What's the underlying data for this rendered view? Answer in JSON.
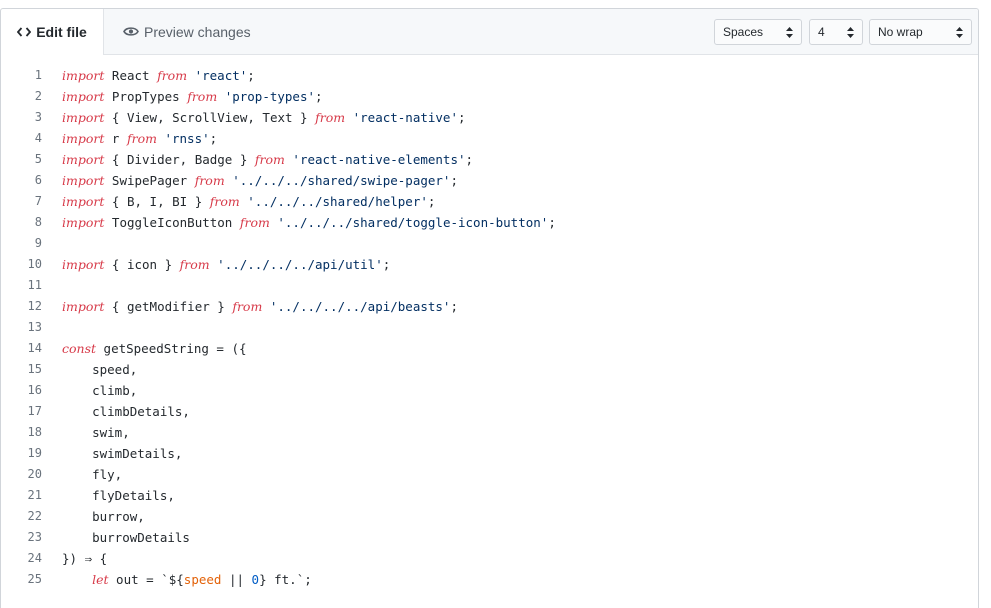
{
  "tabs": {
    "edit": {
      "label": "Edit file",
      "icon": "code-icon"
    },
    "preview": {
      "label": "Preview changes",
      "icon": "eye-icon"
    }
  },
  "options": {
    "indent_mode": "Spaces",
    "indent_size": "4",
    "wrap_mode": "No wrap"
  },
  "colors": {
    "keyword": "#d73a49",
    "string": "#032f62",
    "variable": "#e36209",
    "number": "#005cc5"
  },
  "code_lines": [
    {
      "n": "1",
      "tokens": [
        [
          "kw",
          "import"
        ],
        [
          "p",
          " React "
        ],
        [
          "kw",
          "from"
        ],
        [
          "p",
          " "
        ],
        [
          "str",
          "'react'"
        ],
        [
          "p",
          ";"
        ]
      ]
    },
    {
      "n": "2",
      "tokens": [
        [
          "kw",
          "import"
        ],
        [
          "p",
          " PropTypes "
        ],
        [
          "kw",
          "from"
        ],
        [
          "p",
          " "
        ],
        [
          "str",
          "'prop-types'"
        ],
        [
          "p",
          ";"
        ]
      ]
    },
    {
      "n": "3",
      "tokens": [
        [
          "kw",
          "import"
        ],
        [
          "p",
          " { View, ScrollView, Text } "
        ],
        [
          "kw",
          "from"
        ],
        [
          "p",
          " "
        ],
        [
          "str",
          "'react-native'"
        ],
        [
          "p",
          ";"
        ]
      ]
    },
    {
      "n": "4",
      "tokens": [
        [
          "kw",
          "import"
        ],
        [
          "p",
          " r "
        ],
        [
          "kw",
          "from"
        ],
        [
          "p",
          " "
        ],
        [
          "str",
          "'rnss'"
        ],
        [
          "p",
          ";"
        ]
      ]
    },
    {
      "n": "5",
      "tokens": [
        [
          "kw",
          "import"
        ],
        [
          "p",
          " { Divider, Badge } "
        ],
        [
          "kw",
          "from"
        ],
        [
          "p",
          " "
        ],
        [
          "str",
          "'react-native-elements'"
        ],
        [
          "p",
          ";"
        ]
      ]
    },
    {
      "n": "6",
      "tokens": [
        [
          "kw",
          "import"
        ],
        [
          "p",
          " SwipePager "
        ],
        [
          "kw",
          "from"
        ],
        [
          "p",
          " "
        ],
        [
          "str",
          "'../../../shared/swipe-pager'"
        ],
        [
          "p",
          ";"
        ]
      ]
    },
    {
      "n": "7",
      "tokens": [
        [
          "kw",
          "import"
        ],
        [
          "p",
          " { B, I, BI } "
        ],
        [
          "kw",
          "from"
        ],
        [
          "p",
          " "
        ],
        [
          "str",
          "'../../../shared/helper'"
        ],
        [
          "p",
          ";"
        ]
      ]
    },
    {
      "n": "8",
      "tokens": [
        [
          "kw",
          "import"
        ],
        [
          "p",
          " ToggleIconButton "
        ],
        [
          "kw",
          "from"
        ],
        [
          "p",
          " "
        ],
        [
          "str",
          "'../../../shared/toggle-icon-button'"
        ],
        [
          "p",
          ";"
        ]
      ]
    },
    {
      "n": "9",
      "tokens": []
    },
    {
      "n": "10",
      "tokens": [
        [
          "kw",
          "import"
        ],
        [
          "p",
          " { icon } "
        ],
        [
          "kw",
          "from"
        ],
        [
          "p",
          " "
        ],
        [
          "str",
          "'../../../../api/util'"
        ],
        [
          "p",
          ";"
        ]
      ]
    },
    {
      "n": "11",
      "tokens": []
    },
    {
      "n": "12",
      "tokens": [
        [
          "kw",
          "import"
        ],
        [
          "p",
          " { getModifier } "
        ],
        [
          "kw",
          "from"
        ],
        [
          "p",
          " "
        ],
        [
          "str",
          "'../../../../api/beasts'"
        ],
        [
          "p",
          ";"
        ]
      ]
    },
    {
      "n": "13",
      "tokens": []
    },
    {
      "n": "14",
      "tokens": [
        [
          "kw",
          "const"
        ],
        [
          "p",
          " getSpeedString = ({"
        ]
      ]
    },
    {
      "n": "15",
      "tokens": [
        [
          "p",
          "    speed,"
        ]
      ]
    },
    {
      "n": "16",
      "tokens": [
        [
          "p",
          "    climb,"
        ]
      ]
    },
    {
      "n": "17",
      "tokens": [
        [
          "p",
          "    climbDetails,"
        ]
      ]
    },
    {
      "n": "18",
      "tokens": [
        [
          "p",
          "    swim,"
        ]
      ]
    },
    {
      "n": "19",
      "tokens": [
        [
          "p",
          "    swimDetails,"
        ]
      ]
    },
    {
      "n": "20",
      "tokens": [
        [
          "p",
          "    fly,"
        ]
      ]
    },
    {
      "n": "21",
      "tokens": [
        [
          "p",
          "    flyDetails,"
        ]
      ]
    },
    {
      "n": "22",
      "tokens": [
        [
          "p",
          "    burrow,"
        ]
      ]
    },
    {
      "n": "23",
      "tokens": [
        [
          "p",
          "    burrowDetails"
        ]
      ]
    },
    {
      "n": "24",
      "tokens": [
        [
          "p",
          "}) ⇒ {"
        ]
      ]
    },
    {
      "n": "25",
      "tokens": [
        [
          "p",
          "    "
        ],
        [
          "kw",
          "let"
        ],
        [
          "p",
          " out = `${"
        ],
        [
          "var",
          "speed"
        ],
        [
          "p",
          " || "
        ],
        [
          "num",
          "0"
        ],
        [
          "p",
          "} ft.`;"
        ]
      ]
    }
  ]
}
